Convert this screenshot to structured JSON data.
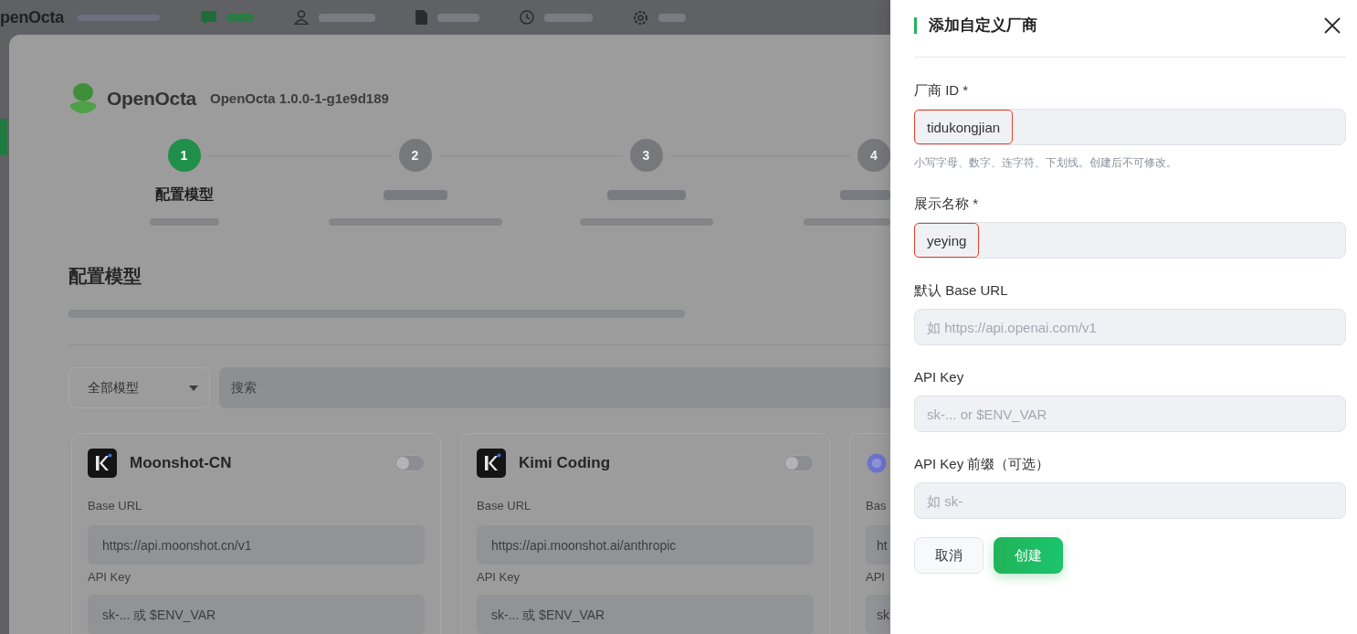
{
  "backdrop": {
    "top_bar": {
      "brand": "penOcta",
      "nav": [
        {
          "selected": true
        },
        {
          "selected": false
        },
        {
          "selected": false
        },
        {
          "selected": false
        },
        {
          "selected": false
        }
      ]
    },
    "sidebar": {
      "items": [
        {
          "selected": true
        }
      ]
    },
    "header": {
      "app_name": "OpenOcta",
      "version": "OpenOcta 1.0.0-1-g1e9d189"
    },
    "steps": [
      {
        "number": "1",
        "title": "配置模型",
        "selected": true
      },
      {
        "number": "2",
        "selected": false
      },
      {
        "number": "3",
        "selected": false
      },
      {
        "number": "4",
        "selected": false
      }
    ],
    "section": {
      "title": "配置模型"
    },
    "filter": {
      "value": "全部模型",
      "search_placeholder": "搜索"
    },
    "providers": [
      {
        "name": "Moonshot-CN",
        "on": false,
        "base_url_label": "Base URL",
        "base_url_placeholder": "https://api.moonshot.cn/v1",
        "api_key_label": "API Key",
        "api_key_placeholder": "sk-... 或 $ENV_VAR"
      },
      {
        "name": "Kimi Coding",
        "on": false,
        "base_url_label": "Base URL",
        "base_url_placeholder": "https://api.moonshot.ai/anthropic",
        "api_key_label": "API Key",
        "api_key_placeholder": "sk-... 或 $ENV_VAR"
      },
      {
        "base_url_label": "Bas",
        "base_url_placeholder": "ht",
        "api_key_label": "API",
        "api_key_placeholder": "sk"
      }
    ]
  },
  "drawer": {
    "title": "添加自定义厂商",
    "fields": [
      {
        "label": "厂商 ID *",
        "value": "tidukongjian",
        "highlighted": true,
        "hint": "小写字母、数字、连字符、下划线。创建后不可修改。"
      },
      {
        "label": "展示名称 *",
        "value": "yeying",
        "highlighted": true
      },
      {
        "label": "默认 Base URL",
        "placeholder": "如 https://api.openai.com/v1",
        "highlighted": false
      },
      {
        "label": "API Key",
        "placeholder": "sk-... or $ENV_VAR",
        "highlighted": false
      },
      {
        "label": "API Key 前缀（可选）",
        "placeholder": "如 sk-",
        "highlighted": false
      }
    ],
    "buttons": [
      {
        "label": "取消",
        "kind": "secondary"
      },
      {
        "label": "创建",
        "kind": "primary"
      }
    ]
  }
}
